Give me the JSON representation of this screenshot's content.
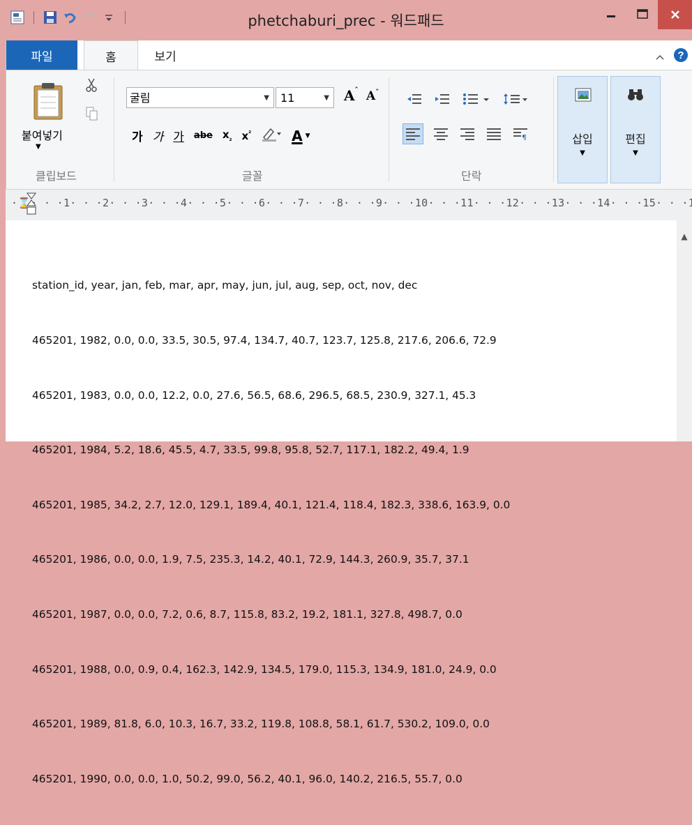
{
  "window": {
    "title": "phetchaburi_prec - 워드패드"
  },
  "tabs": {
    "file": "파일",
    "home": "홈",
    "view": "보기"
  },
  "ribbon": {
    "clipboard": {
      "paste_label": "붙여넣기",
      "group_label": "클립보드"
    },
    "font": {
      "font_name": "굴림",
      "font_size": "11",
      "grow_label": "A",
      "shrink_label": "A",
      "bold": "가",
      "italic": "가",
      "underline": "가",
      "strike": "abe",
      "subscript": "x",
      "superscript": "x",
      "color_label": "A",
      "group_label": "글꼴"
    },
    "paragraph": {
      "group_label": "단락"
    },
    "insert": {
      "label": "삽입"
    },
    "edit": {
      "label": "편집"
    }
  },
  "ruler": {
    "text": "·⌛· · ·1· · ·2· · ·3· · ·4· · ·5· · ·6· · ·7· · ·8· · ·9· · ·10· · ·11· · ·12· · ·13· · ·14· · ·15· · ·1"
  },
  "document": {
    "lines": [
      "station_id, year, jan, feb, mar, apr, may, jun, jul, aug, sep, oct, nov, dec",
      "465201, 1982, 0.0, 0.0, 33.5, 30.5, 97.4, 134.7, 40.7, 123.7, 125.8, 217.6, 206.6, 72.9",
      "465201, 1983, 0.0, 0.0, 12.2, 0.0, 27.6, 56.5, 68.6, 296.5, 68.5, 230.9, 327.1, 45.3",
      "465201, 1984, 5.2, 18.6, 45.5, 4.7, 33.5, 99.8, 95.8, 52.7, 117.1, 182.2, 49.4, 1.9",
      "465201, 1985, 34.2, 2.7, 12.0, 129.1, 189.4, 40.1, 121.4, 118.4, 182.3, 338.6, 163.9, 0.0",
      "465201, 1986, 0.0, 0.0, 1.9, 7.5, 235.3, 14.2, 40.1, 72.9, 144.3, 260.9, 35.7, 37.1",
      "465201, 1987, 0.0, 0.0, 7.2, 0.6, 8.7, 115.8, 83.2, 19.2, 181.1, 327.8, 498.7, 0.0",
      "465201, 1988, 0.0, 0.9, 0.4, 162.3, 142.9, 134.5, 179.0, 115.3, 134.9, 181.0, 24.9, 0.0",
      "465201, 1989, 81.8, 6.0, 10.3, 16.7, 33.2, 119.8, 108.8, 58.1, 61.7, 530.2, 109.0, 0.0",
      "465201, 1990, 0.0, 0.0, 1.0, 50.2, 99.0, 56.2, 40.1, 96.0, 140.2, 216.5, 55.7, 0.0"
    ]
  },
  "colors": {
    "titlebar": "#e3a7a6",
    "file_tab": "#1c66b8",
    "close_button": "#c7504b"
  }
}
